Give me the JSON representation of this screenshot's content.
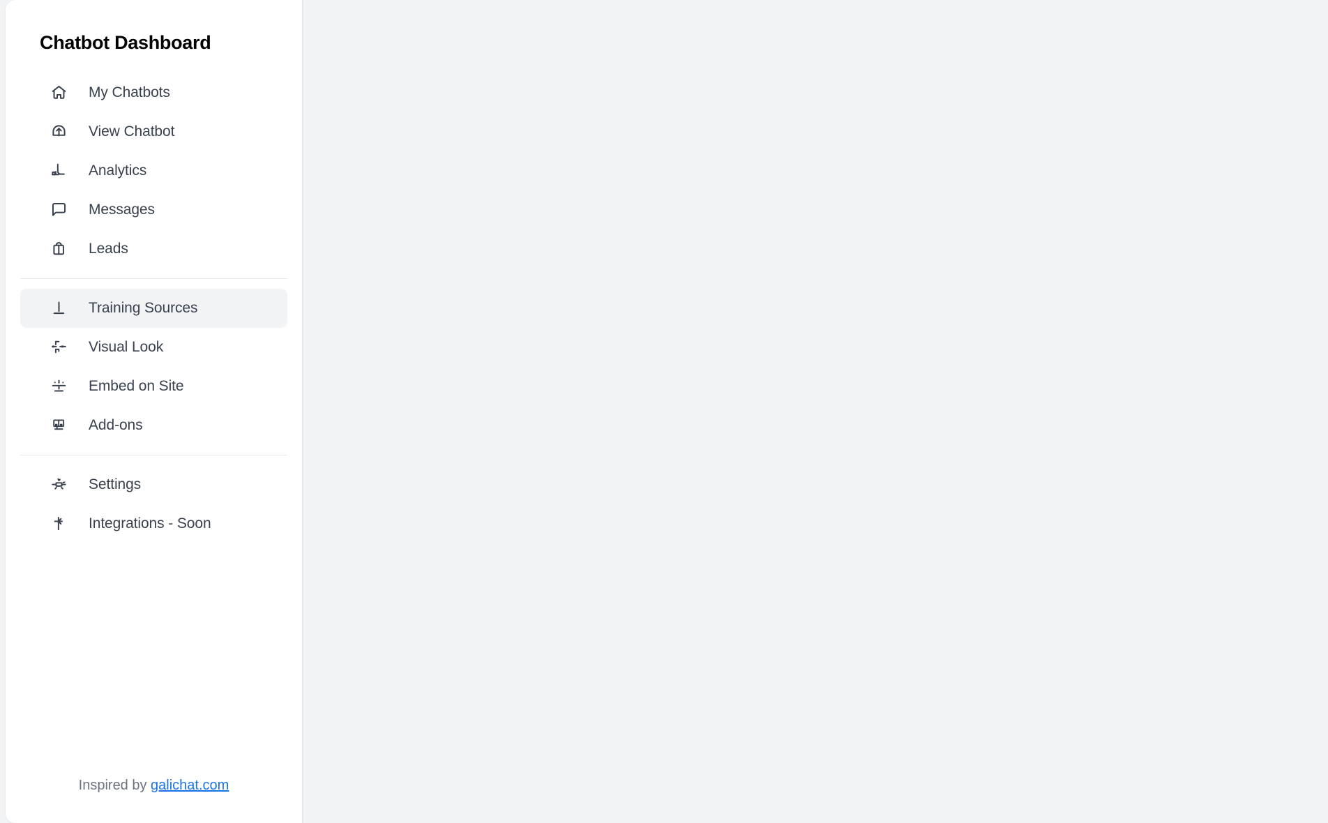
{
  "sidebar": {
    "title": "Chatbot Dashboard",
    "groups": [
      {
        "items": [
          {
            "label": "My Chatbots",
            "icon": "home-icon",
            "active": false
          },
          {
            "label": "View Chatbot",
            "icon": "upload-circle-icon",
            "active": false
          },
          {
            "label": "Analytics",
            "icon": "bar-chart-icon",
            "active": false
          },
          {
            "label": "Messages",
            "icon": "message-bubble-icon",
            "active": false
          },
          {
            "label": "Leads",
            "icon": "briefcase-icon",
            "active": false
          }
        ]
      },
      {
        "items": [
          {
            "label": "Training Sources",
            "icon": "file-upload-icon",
            "active": true
          },
          {
            "label": "Visual Look",
            "icon": "sliders-icon",
            "active": false
          },
          {
            "label": "Embed on Site",
            "icon": "code-embed-icon",
            "active": false
          },
          {
            "label": "Add-ons",
            "icon": "layout-grid-icon",
            "active": false
          }
        ]
      },
      {
        "items": [
          {
            "label": "Settings",
            "icon": "gear-icon",
            "active": false
          },
          {
            "label": "Integrations - Soon",
            "icon": "plug-icon",
            "active": false
          }
        ]
      }
    ],
    "footer": {
      "prefix": "Inspired by ",
      "link_text": "galichat.com"
    }
  },
  "colors": {
    "accent_link": "#1a73e8",
    "sidebar_bg": "#ffffff",
    "main_bg": "#f1f3f5",
    "active_item_bg": "#f1f3f5",
    "label_text": "#39414f",
    "title_text": "#000000"
  },
  "main": {
    "content": ""
  }
}
